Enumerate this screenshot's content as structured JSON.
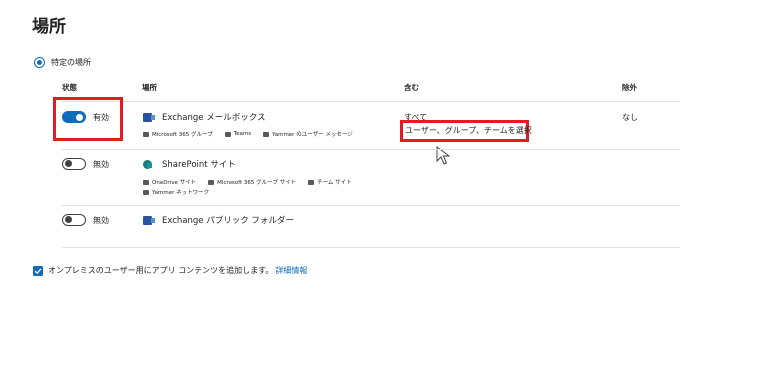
{
  "title": "場所",
  "radio": {
    "label": "特定の場所"
  },
  "columns": {
    "status": "状態",
    "location": "場所",
    "include": "含む",
    "exclude": "除外"
  },
  "rows": [
    {
      "toggle_on": true,
      "status": "有効",
      "icon": "exchange-icon",
      "name": "Exchange メールボックス",
      "sub": [
        "Microsoft 365 グループ",
        "Teams",
        "Yammer のユーザー メッセージ"
      ],
      "include_text": "すべて",
      "include_link": "ユーザー、グループ、チームを選択",
      "exclude": "なし"
    },
    {
      "toggle_on": false,
      "status": "無効",
      "icon": "sharepoint-icon",
      "name": "SharePoint サイト",
      "sub": [
        "OneDrive サイト",
        "Microsoft 365 グループ サイト",
        "チーム サイト",
        "Yammer ネットワーク"
      ]
    },
    {
      "toggle_on": false,
      "status": "無効",
      "icon": "exchange-icon",
      "name": "Exchange パブリック フォルダー"
    }
  ],
  "checkbox": {
    "label": "オンプレミスのユーザー用にアプリ コンテンツを追加します。",
    "link": "詳細情報",
    "checked": true
  },
  "colors": {
    "accent": "#0f6cbd",
    "highlight": "#e31b23"
  }
}
